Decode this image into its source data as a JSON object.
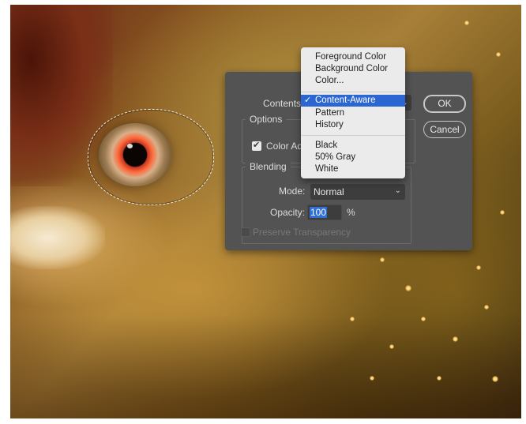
{
  "dialog": {
    "contents_label": "Contents",
    "ok_label": "OK",
    "cancel_label": "Cancel",
    "options": {
      "title": "Options",
      "color_adapt_label": "Color Adapt",
      "color_adapt_checked": true
    },
    "blending": {
      "title": "Blending",
      "mode_label": "Mode:",
      "mode_value": "Normal",
      "opacity_label": "Opacity:",
      "opacity_value": "100",
      "opacity_unit": "%",
      "preserve_transparency_label": "Preserve Transparency",
      "preserve_transparency_enabled": false
    }
  },
  "contents_menu": {
    "selected": "Content-Aware",
    "check_glyph": "✓",
    "items": [
      "Foreground Color",
      "Background Color",
      "Color...",
      "Content-Aware",
      "Pattern",
      "History",
      "Black",
      "50% Gray",
      "White"
    ]
  },
  "icons": {
    "chevron": "chevron-down-icon",
    "check": "checkmark-icon"
  },
  "colors": {
    "dialog_bg": "#535353",
    "menu_bg": "#ebebeb",
    "menu_highlight": "#2b66d3",
    "text_selection": "#2f6fd6"
  }
}
